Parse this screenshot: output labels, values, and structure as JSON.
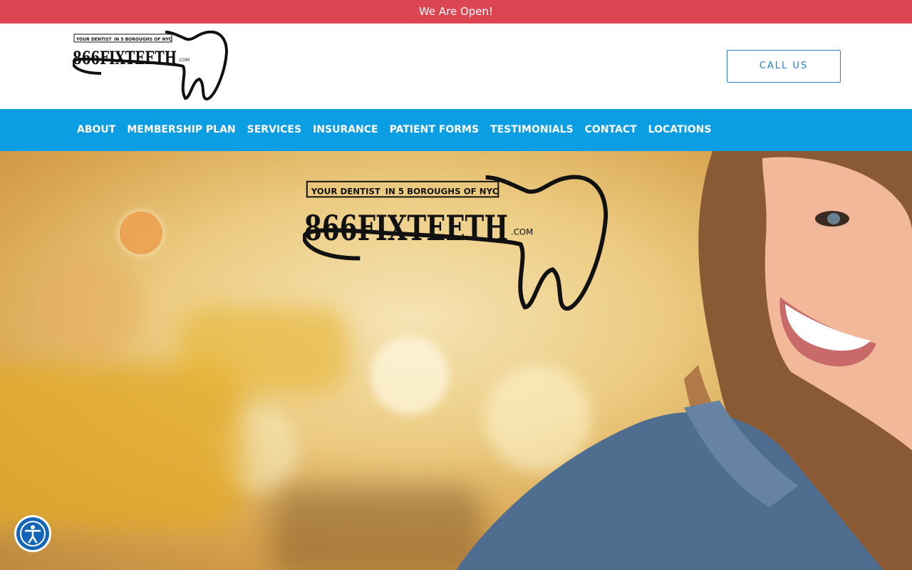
{
  "announcement": "We Are Open!",
  "header": {
    "logo": {
      "tagline_left": "YOUR DENTIST",
      "tagline_right": "IN 5 BOROUGHS OF NYC",
      "wordmark": "866FIXTEETH",
      "suffix": ".COM"
    },
    "call_label": "CALL US"
  },
  "nav": {
    "items": [
      {
        "label": "ABOUT"
      },
      {
        "label": "MEMBERSHIP PLAN"
      },
      {
        "label": "SERVICES"
      },
      {
        "label": "INSURANCE"
      },
      {
        "label": "PATIENT FORMS"
      },
      {
        "label": "TESTIMONIALS"
      },
      {
        "label": "CONTACT"
      },
      {
        "label": "LOCATIONS"
      }
    ]
  },
  "hero": {
    "logo": {
      "tagline_left": "YOUR DENTIST",
      "tagline_right": "IN 5 BOROUGHS OF NYC",
      "wordmark": "866FIXTEETH",
      "suffix": ".COM"
    }
  },
  "accessibility": {
    "icon": "accessibility-icon"
  },
  "colors": {
    "announcement_bg": "#dc4652",
    "nav_bg": "#0c9ee3",
    "accent": "#2a7fc8"
  }
}
